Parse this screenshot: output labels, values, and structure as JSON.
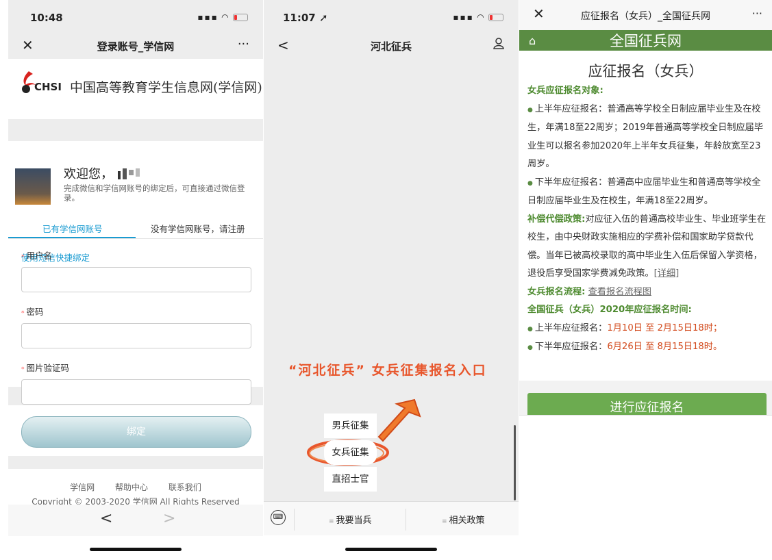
{
  "panel1": {
    "status_time": "10:48",
    "nav_title": "登录账号_学信网",
    "nav_close": "✕",
    "nav_more": "···",
    "logo_text": "CHSI",
    "site_name": "中国高等教育学生信息网(学信网)",
    "welcome": "欢迎您，",
    "welcome_sub": "完成微信和学信网账号的绑定后，可直接通过微信登录。",
    "tab_active": "已有学信网账号",
    "tab_other": "没有学信网账号，请注册",
    "sms_link": "使用短信快捷绑定",
    "req_mark": "*",
    "field_username": "用户名",
    "field_password": "密码",
    "field_captcha": "图片验证码",
    "bind_button": "绑定",
    "footer_links": [
      "学信网",
      "帮助中心",
      "联系我们"
    ],
    "copyright": "Copyright © 2003-2020 学信网 All Rights Reserved",
    "back": "<",
    "forward": ">"
  },
  "panel2": {
    "status_time": "11:07",
    "nav_title": "河北征兵",
    "nav_back": "<",
    "banner": "“河北征兵” 女兵征集报名入口",
    "menu": [
      "男兵征集",
      "女兵征集",
      "直招士官"
    ],
    "keyboard_icon": "⌨",
    "tab1": "我要当兵",
    "tab2": "相关政策",
    "tab_dot": "≡"
  },
  "panel3": {
    "close": "✕",
    "title": "应征报名（女兵）_全国征兵网",
    "more": "···",
    "home_icon": "⌂",
    "site": "全国征兵网",
    "heading": "应征报名（女兵）",
    "s1_label": "女兵应征报名对象:",
    "p1": "上半年应征报名：普通高等学校全日制应届毕业生及在校生，年满18至22周岁；2019年普通高等学校全日制应届毕业生可以报名参加2020年上半年女兵征集，年龄放宽至23周岁。",
    "p2": "下半年应征报名：普通高中应届毕业生和普通高等学校全日制应届毕业生及在校生，年满18至22周岁。",
    "s2_label": "补偿代偿政策:",
    "p3": "对应征入伍的普通高校毕业生、毕业班学生在校生，由中央财政实施相应的学费补偿和国家助学贷款代偿。当年已被高校录取的高中毕业生入伍后保留入学资格，退役后享受国家学费减免政策。",
    "p3_link": "[详细]",
    "s3_label": "女兵报名流程:",
    "s3_link": "查看报名流程图",
    "s4_label": "全国征兵（女兵）2020年应征报名时间:",
    "t1_label": "上半年应征报名：",
    "t1_value": "1月10日 至 2月15日18时；",
    "t2_label": "下半年应征报名：",
    "t2_value": "6月26日 至 8月15日18时。",
    "bullet": "●",
    "button": "进行应征报名"
  }
}
